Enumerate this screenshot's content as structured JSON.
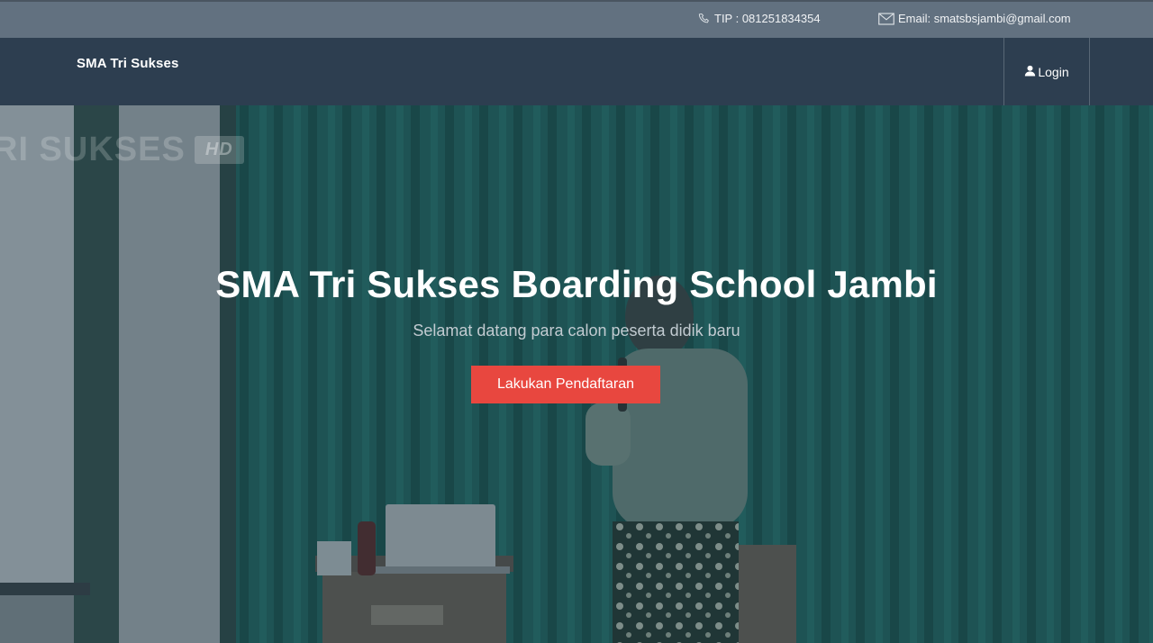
{
  "topbar": {
    "phone_icon": "phone-icon",
    "phone_text": "TIP : 081251834354",
    "email_icon": "envelope-icon",
    "email_text": "Email: smatsbsjambi@gmail.com"
  },
  "navbar": {
    "brand": "SMA Tri Sukses",
    "login_icon": "user-icon",
    "login_label": "Login"
  },
  "hero": {
    "watermark_text": "RI SUKSES",
    "watermark_badge": "HD",
    "title": "SMA Tri Sukses Boarding School Jambi",
    "subtitle": "Selamat datang para calon peserta didik baru",
    "cta_label": "Lakukan Pendaftaran"
  },
  "colors": {
    "topbar_bg": "#627180",
    "navbar_bg": "#2d3e50",
    "cta_bg": "#e8473f",
    "hero_tint": "#1e5d59"
  }
}
